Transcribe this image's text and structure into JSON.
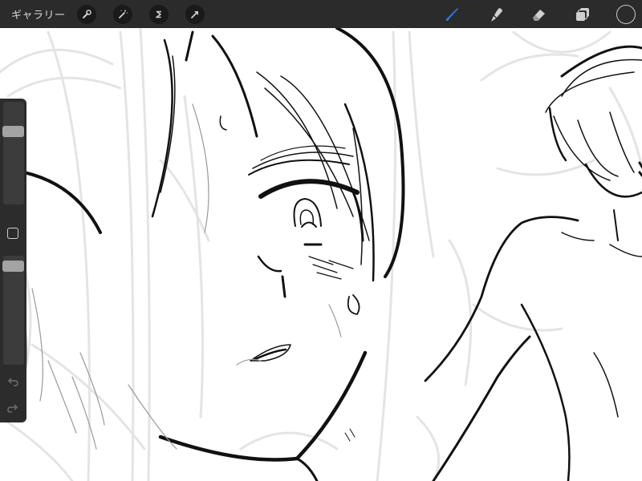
{
  "topbar": {
    "gallery_label": "ギャラリー",
    "adjust_tools": [
      {
        "name": "actions",
        "icon": "wrench-icon"
      },
      {
        "name": "adjustments",
        "icon": "magic-wand-icon"
      },
      {
        "name": "selection",
        "icon": "selection-s-icon"
      },
      {
        "name": "transform",
        "icon": "arrow-cursor-icon"
      }
    ],
    "paint_tools": [
      {
        "name": "brush",
        "icon": "brush-icon",
        "active": true
      },
      {
        "name": "smudge",
        "icon": "smudge-icon",
        "active": false
      },
      {
        "name": "eraser",
        "icon": "eraser-icon",
        "active": false
      },
      {
        "name": "layers",
        "icon": "layers-icon",
        "active": false
      }
    ],
    "active_color": "#2b2b2b"
  },
  "sidebar": {
    "brush_size_level": 0.74,
    "opacity_level": 0.95,
    "buttons": [
      {
        "name": "modify",
        "icon": "square-icon"
      },
      {
        "name": "undo",
        "icon": "undo-arrow-icon"
      },
      {
        "name": "redo",
        "icon": "redo-arrow-icon"
      }
    ]
  },
  "colors": {
    "toolbar_bg": "#2b2b2b",
    "accent_blue": "#2b7cf5",
    "icon_gray": "#cfcfcf",
    "sketch_line": "#111111",
    "guide_line": "#e3e3e3"
  }
}
